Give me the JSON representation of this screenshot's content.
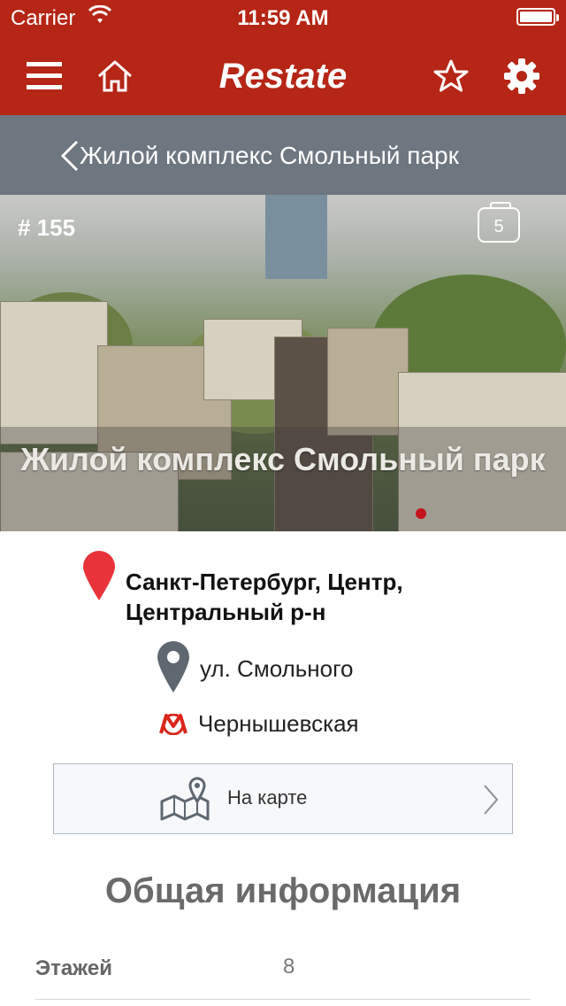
{
  "status_bar": {
    "carrier": "Carrier",
    "time": "11:59 AM"
  },
  "navbar": {
    "logo": "Restate",
    "icons": [
      "menu-icon",
      "home-icon",
      "star-icon",
      "gear-icon"
    ]
  },
  "subheader": {
    "back_title": "Жилой комплекс Смольный парк"
  },
  "listing": {
    "number": "# 155",
    "photo_count": "5",
    "title": "Жилой комплекс Смольный парк"
  },
  "location": {
    "city_line1": "Санкт-Петербург, Центр,",
    "city_line2": "Центральный р-н",
    "street": "ул. Смольного",
    "metro": "Чернышевская",
    "map_button": "На карте"
  },
  "general_info": {
    "heading": "Общая информация",
    "rows": [
      {
        "key": "Этажей",
        "value": "8"
      }
    ]
  },
  "colors": {
    "accent": "#b52616",
    "subheader": "#6e7680",
    "metro": "#d9261c"
  }
}
